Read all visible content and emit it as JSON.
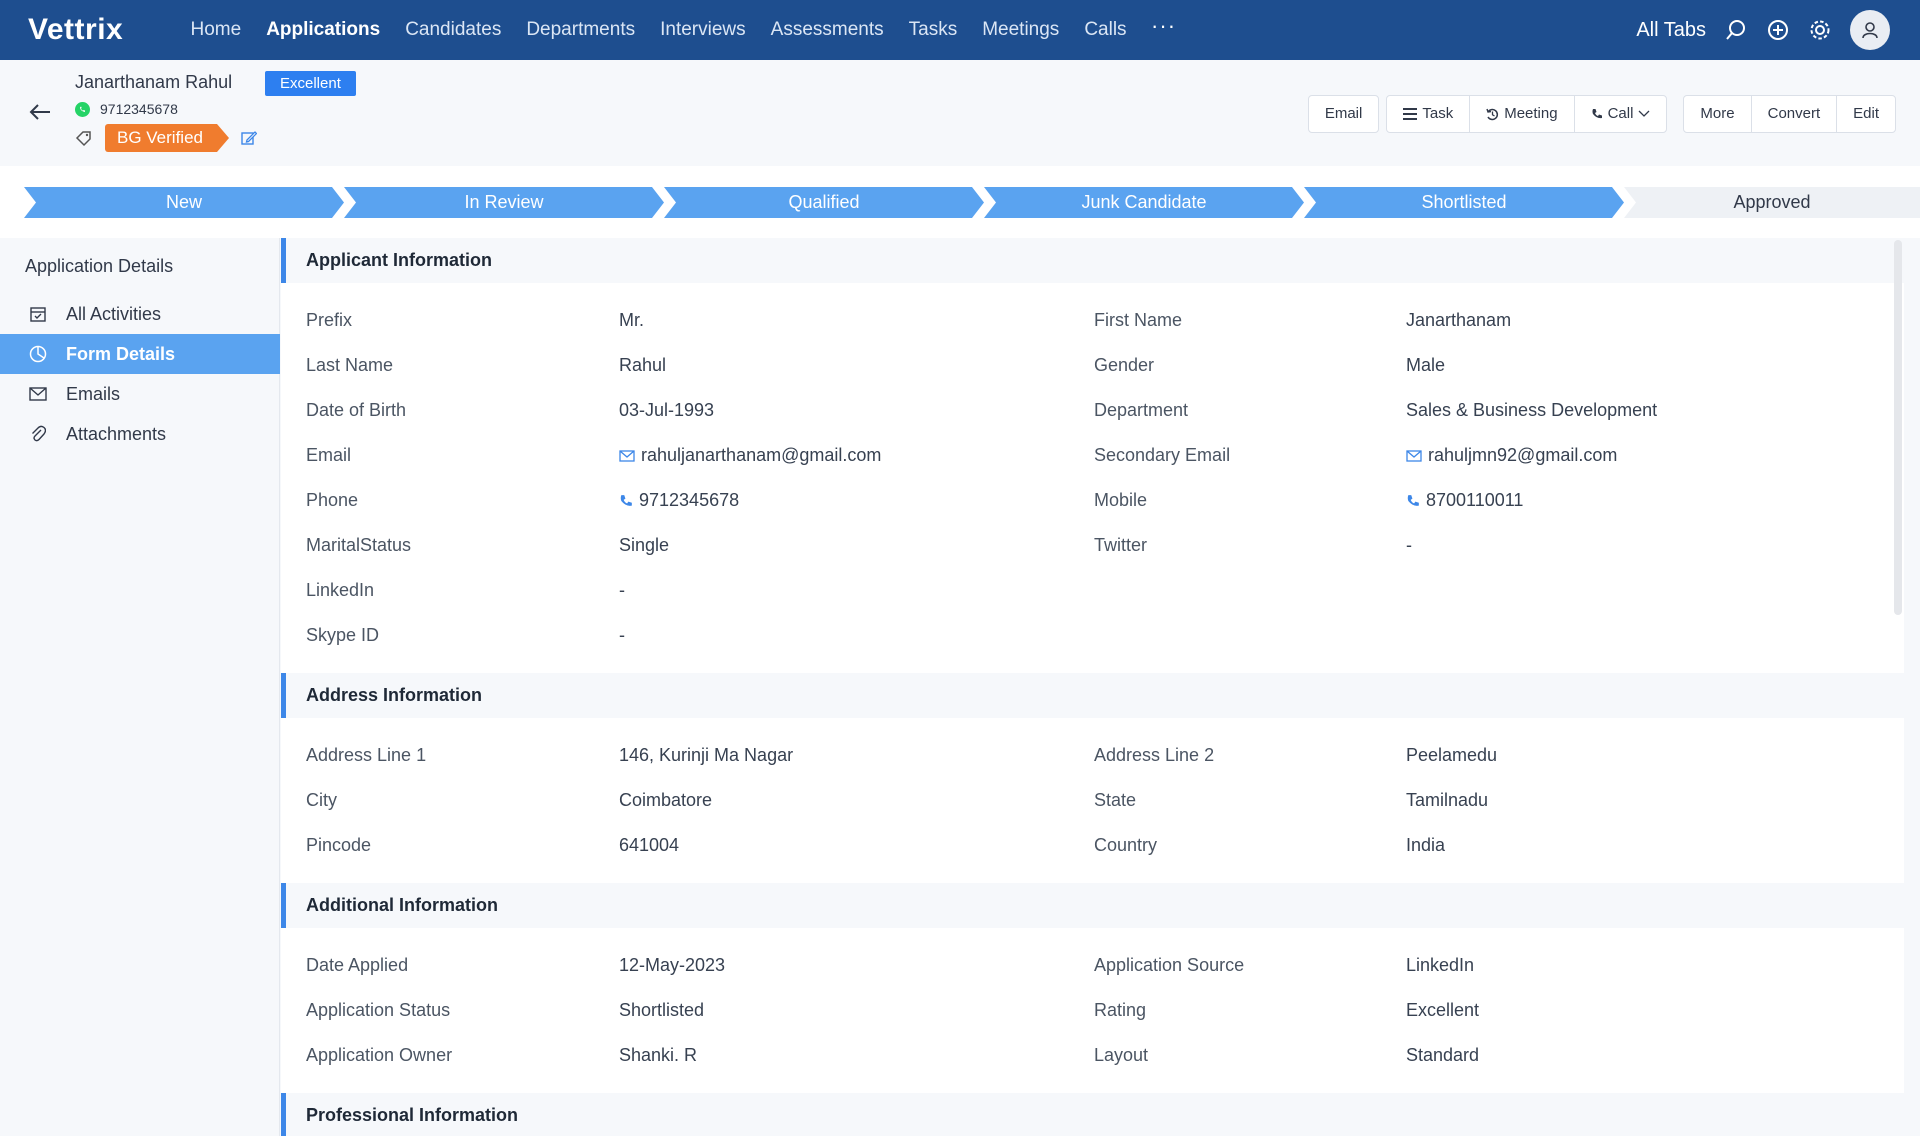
{
  "nav": {
    "logo": "Vettrix",
    "items": [
      "Home",
      "Applications",
      "Candidates",
      "Departments",
      "Interviews",
      "Assessments",
      "Tasks",
      "Meetings",
      "Calls"
    ],
    "active": "Applications",
    "more": "···",
    "all_tabs": "All Tabs"
  },
  "record": {
    "name": "Janarthanam Rahul",
    "rating_badge": "Excellent",
    "phone": "9712345678",
    "tag": "BG Verified"
  },
  "actions": {
    "email": "Email",
    "task": "Task",
    "meeting": "Meeting",
    "call": "Call",
    "more": "More",
    "convert": "Convert",
    "edit": "Edit"
  },
  "stages": [
    {
      "label": "New",
      "done": true
    },
    {
      "label": "In Review",
      "done": true
    },
    {
      "label": "Qualified",
      "done": true
    },
    {
      "label": "Junk Candidate",
      "done": true
    },
    {
      "label": "Shortlisted",
      "done": true
    },
    {
      "label": "Approved",
      "done": false
    }
  ],
  "colors": {
    "nav_bg": "#1e4e8f",
    "stage_done": "#5aa3f0",
    "accent": "#2d7ff0",
    "tag": "#f07c2e"
  },
  "left_panel": {
    "title": "Application Details",
    "items": [
      {
        "label": "All Activities",
        "icon": "calendar-check-icon"
      },
      {
        "label": "Form Details",
        "icon": "pie-chart-icon",
        "active": true
      },
      {
        "label": "Emails",
        "icon": "mail-icon"
      },
      {
        "label": "Attachments",
        "icon": "paperclip-icon"
      }
    ]
  },
  "sections": [
    {
      "title": "Applicant Information",
      "rows": [
        [
          {
            "label": "Prefix",
            "value": "Mr."
          },
          {
            "label": "First Name",
            "value": "Janarthanam"
          }
        ],
        [
          {
            "label": "Last Name",
            "value": "Rahul"
          },
          {
            "label": "Gender",
            "value": "Male"
          }
        ],
        [
          {
            "label": "Date of Birth",
            "value": "03-Jul-1993"
          },
          {
            "label": "Department",
            "value": "Sales & Business Development"
          }
        ],
        [
          {
            "label": "Email",
            "value": "rahuljanarthanam@gmail.com",
            "icon": "mail"
          },
          {
            "label": "Secondary Email",
            "value": "rahuljmn92@gmail.com",
            "icon": "mail"
          }
        ],
        [
          {
            "label": "Phone",
            "value": "9712345678",
            "icon": "phone"
          },
          {
            "label": "Mobile",
            "value": "8700110011",
            "icon": "phone"
          }
        ],
        [
          {
            "label": "MaritalStatus",
            "value": "Single"
          },
          {
            "label": "Twitter",
            "value": "-"
          }
        ],
        [
          {
            "label": "LinkedIn",
            "value": "-"
          }
        ],
        [
          {
            "label": "Skype ID",
            "value": "-"
          }
        ]
      ]
    },
    {
      "title": "Address Information",
      "rows": [
        [
          {
            "label": "Address Line 1",
            "value": "146, Kurinji Ma Nagar"
          },
          {
            "label": "Address Line 2",
            "value": "Peelamedu"
          }
        ],
        [
          {
            "label": "City",
            "value": "Coimbatore"
          },
          {
            "label": "State",
            "value": "Tamilnadu"
          }
        ],
        [
          {
            "label": "Pincode",
            "value": "641004"
          },
          {
            "label": "Country",
            "value": "India"
          }
        ]
      ]
    },
    {
      "title": "Additional Information",
      "rows": [
        [
          {
            "label": "Date Applied",
            "value": "12-May-2023"
          },
          {
            "label": "Application Source",
            "value": "LinkedIn"
          }
        ],
        [
          {
            "label": "Application Status",
            "value": "Shortlisted"
          },
          {
            "label": "Rating",
            "value": "Excellent"
          }
        ],
        [
          {
            "label": "Application Owner",
            "value": "Shanki. R"
          },
          {
            "label": "Layout",
            "value": "Standard"
          }
        ]
      ]
    },
    {
      "title": "Professional Information",
      "rows": []
    }
  ]
}
